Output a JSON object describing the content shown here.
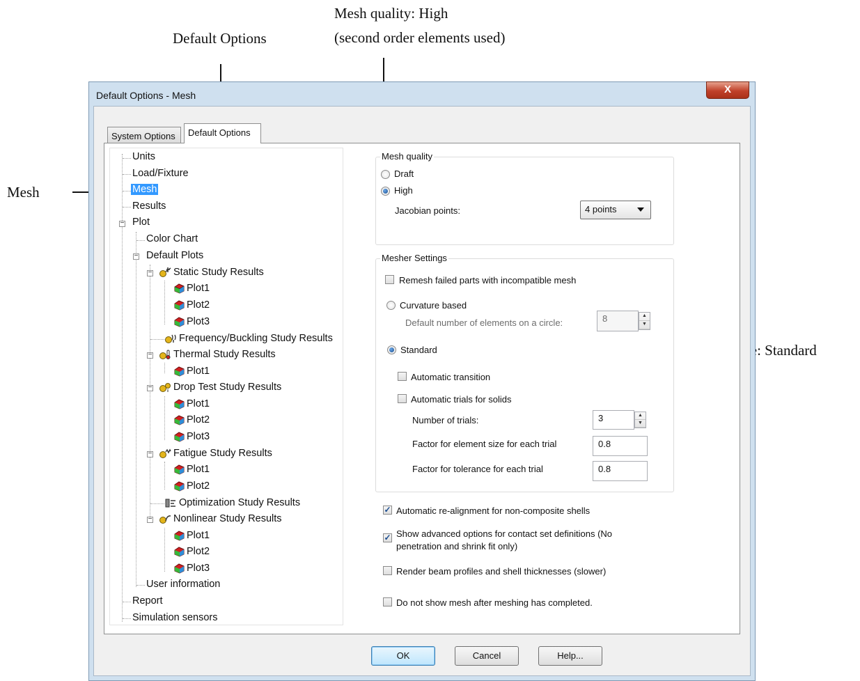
{
  "callouts": {
    "default_options": "Default Options",
    "mesh_quality_line1": "Mesh quality: High",
    "mesh_quality_line2": "(second order elements used)",
    "mesh": "Mesh",
    "mesh_type": "Mesh type: Standard"
  },
  "window": {
    "title": "Default Options - Mesh",
    "close_glyph": "X"
  },
  "tabs": {
    "system_options": "System Options",
    "default_options": "Default Options"
  },
  "tree": {
    "units": "Units",
    "load_fixture": "Load/Fixture",
    "mesh": "Mesh",
    "results": "Results",
    "plot": "Plot",
    "color_chart": "Color Chart",
    "default_plots": "Default Plots",
    "static": "Static Study Results",
    "frequency": "Frequency/Buckling Study Results",
    "thermal": "Thermal Study Results",
    "drop_test": "Drop Test Study Results",
    "fatigue": "Fatigue Study Results",
    "optimization": "Optimization Study Results",
    "nonlinear": "Nonlinear Study Results",
    "plot1": "Plot1",
    "plot2": "Plot2",
    "plot3": "Plot3",
    "user_information": "User information",
    "report": "Report",
    "simulation_sensors": "Simulation sensors"
  },
  "mesh_quality": {
    "legend": "Mesh quality",
    "draft": "Draft",
    "high": "High",
    "jacobian_label": "Jacobian points:",
    "jacobian_value": "4 points"
  },
  "mesher_settings": {
    "legend": "Mesher Settings",
    "remesh": "Remesh failed parts with incompatible mesh",
    "curvature_based": "Curvature based",
    "default_elements_label": "Default number of elements on a circle:",
    "default_elements_value": "8",
    "standard": "Standard",
    "automatic_transition": "Automatic transition",
    "automatic_trials": "Automatic trials for solids",
    "num_trials_label": "Number of trials:",
    "num_trials_value": "3",
    "factor_size_label": "Factor for element size for each trial",
    "factor_size_value": "0.8",
    "factor_tolerance_label": "Factor for tolerance for each trial",
    "factor_tolerance_value": "0.8"
  },
  "options": {
    "realignment": "Automatic re-alignment for non-composite shells",
    "advanced_line1": "Show advanced options for contact set definitions (No",
    "advanced_line2": "penetration and shrink fit only)",
    "render_beam": "Render beam profiles and shell thicknesses (slower)",
    "do_not_show_mesh": "Do not show mesh after meshing has completed.",
    "check_mark": "✓"
  },
  "buttons": {
    "ok": "OK",
    "cancel": "Cancel",
    "help": "Help..."
  }
}
